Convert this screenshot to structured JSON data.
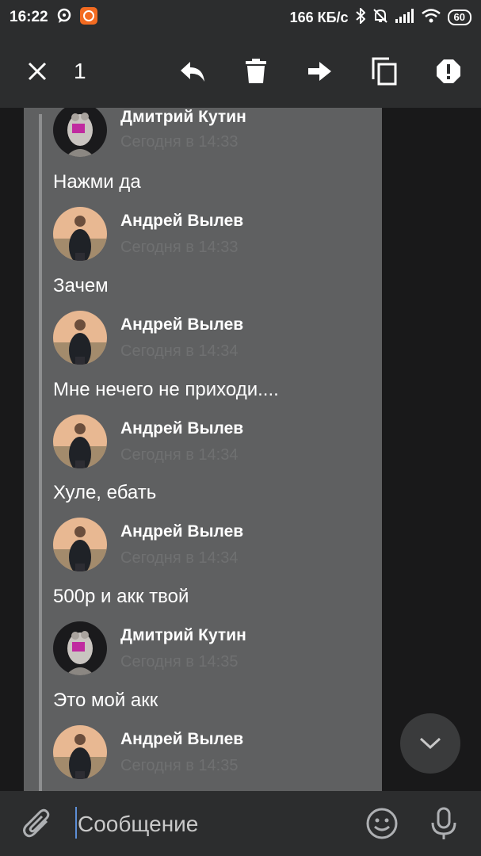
{
  "status_bar": {
    "time": "16:22",
    "speed": "166 КБ/с",
    "battery": "60",
    "icons": [
      "chat-bubble-icon",
      "app-icon",
      "bluetooth-icon",
      "mute-bell-icon",
      "signal-icon",
      "wifi-icon"
    ]
  },
  "action_bar": {
    "selected_count": "1",
    "icons": [
      "close-icon",
      "reply-icon",
      "delete-icon",
      "forward-icon",
      "copy-icon",
      "report-icon"
    ]
  },
  "messages": [
    {
      "author": "Дмитрий Кутин",
      "time": "Сегодня в 14:33",
      "text": "Нажми да",
      "avatar": "statue"
    },
    {
      "author": "Андрей Вылев",
      "time": "Сегодня в 14:33",
      "text": "Зачем",
      "avatar": "person"
    },
    {
      "author": "Андрей Вылев",
      "time": "Сегодня в 14:34",
      "text": "Мне нечего не приходи....",
      "avatar": "person"
    },
    {
      "author": "Андрей Вылев",
      "time": "Сегодня в 14:34",
      "text": "Хуле, ебать",
      "avatar": "person"
    },
    {
      "author": "Андрей Вылев",
      "time": "Сегодня в 14:34",
      "text": "500р и акк твой",
      "avatar": "person"
    },
    {
      "author": "Дмитрий Кутин",
      "time": "Сегодня в 14:35",
      "text": "Это мой акк",
      "avatar": "statue"
    },
    {
      "author": "Андрей Вылев",
      "time": "Сегодня в 14:35",
      "text": "",
      "avatar": "person"
    }
  ],
  "composer": {
    "placeholder": "Сообщение",
    "value": ""
  },
  "colors": {
    "bar_bg": "#2c2d2e",
    "bubble_bg": "#5f6061",
    "muted_time": "#6f7071",
    "caret": "#5d8ed6"
  }
}
